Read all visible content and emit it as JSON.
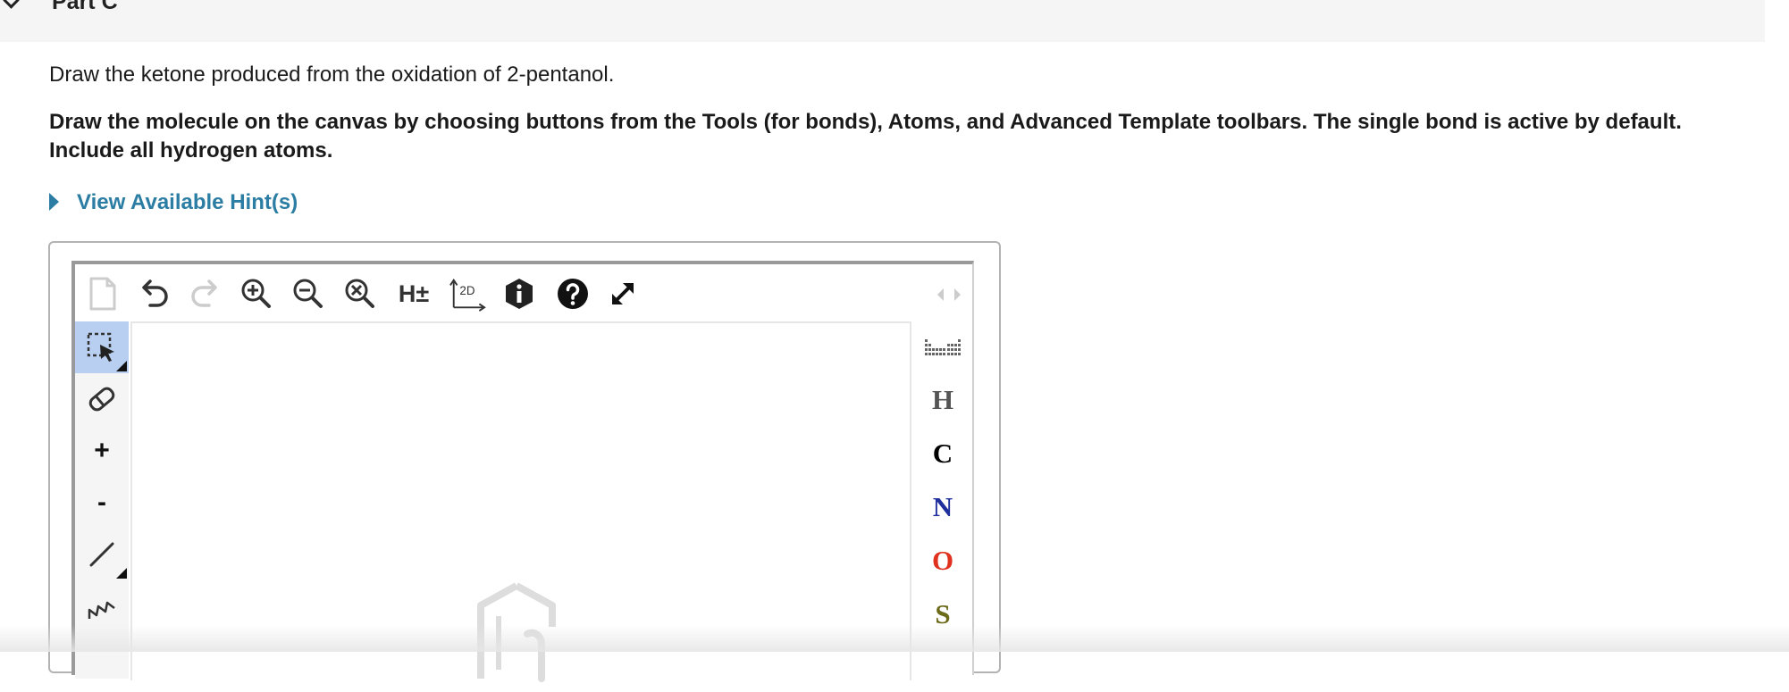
{
  "part": {
    "title": "Part C"
  },
  "question": "Draw the ketone produced from the oxidation of 2-pentanol.",
  "instructions": "Draw the molecule on the canvas by choosing buttons from the Tools (for bonds), Atoms, and Advanced Template toolbars. The single bond is active by default. Include all hydrogen atoms.",
  "hint": {
    "label": "View Available Hint(s)"
  },
  "editor": {
    "top_toolbar": {
      "h_toggle_label": "H±",
      "clean2d_label": "2D"
    },
    "left_toolbar": {
      "charge_plus_label": "+",
      "charge_minus_label": "-"
    },
    "atoms": [
      {
        "symbol": "H",
        "color": "#555555"
      },
      {
        "symbol": "C",
        "color": "#000000"
      },
      {
        "symbol": "N",
        "color": "#1f2f9c"
      },
      {
        "symbol": "O",
        "color": "#e0301e"
      },
      {
        "symbol": "S",
        "color": "#6b6b1a"
      }
    ]
  },
  "colors": {
    "link": "#2b7da3",
    "active_tool": "#b9cff2"
  }
}
